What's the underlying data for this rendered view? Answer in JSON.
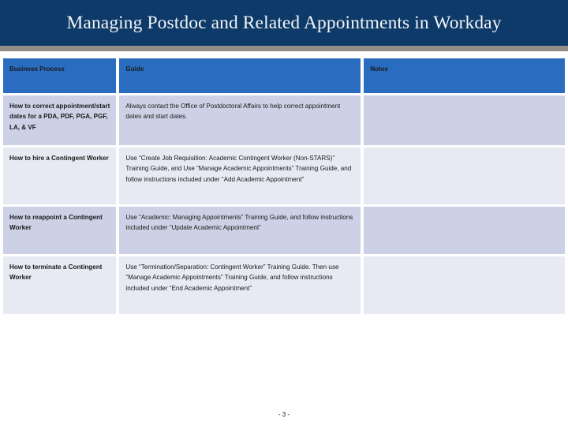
{
  "slide": {
    "title": "Managing Postdoc and Related Appointments in Workday",
    "page_number": "- 3 -",
    "colors": {
      "banner": "#0d3a68",
      "rule": "#918c86",
      "table_header": "#2a6cc0",
      "row_shade_dark": "#ccd1e6",
      "row_shade_light": "#e7eaf3",
      "title_text": "#f2f4f7",
      "body_text": "#1a1a1a"
    }
  },
  "table": {
    "headers": {
      "business_process": "Business Process",
      "guide": "Guide",
      "notes": "Notes"
    },
    "rows": [
      {
        "business_process": "How to correct appointment/start dates for a PDA, PDF, PGA, PGF, LA, & VF",
        "guide": "Always contact the Office of Postdoctoral Affairs to help correct appointment dates and start dates.",
        "notes": ""
      },
      {
        "business_process": "How to hire a Contingent Worker",
        "guide": "Use “Create Job Requisition: Academic Contingent Worker (Non-STARS)” Training Guide, and Use “Manage Academic Appointments” Training Guide, and follow instructions included under “Add Academic Appointment”",
        "notes": ""
      },
      {
        "business_process": "How to reappoint a Contingent Worker",
        "guide": "Use “Academic: Managing Appointments” Training Guide, and follow instructions included under “Update Academic Appointment”",
        "notes": ""
      },
      {
        "business_process": "How to terminate a Contingent Worker",
        "guide": "Use “Termination/Separation: Contingent Worker” Training Guide. Then use  “Manage Academic Appointments” Training Guide, and follow instructions included under “End Academic Appointment”",
        "notes": ""
      }
    ]
  }
}
